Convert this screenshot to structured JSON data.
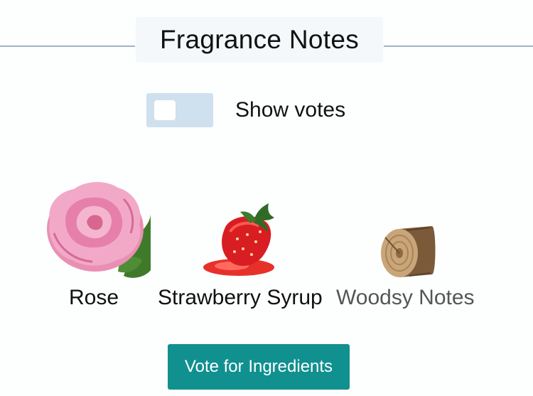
{
  "header": {
    "title": "Fragrance Notes"
  },
  "toggle": {
    "label": "Show votes",
    "checked": false
  },
  "notes": [
    {
      "label": "Rose",
      "icon": "rose-image"
    },
    {
      "label": "Strawberry Syrup",
      "icon": "strawberry-syrup-image"
    },
    {
      "label": "Woodsy Notes",
      "icon": "wood-log-image"
    }
  ],
  "actions": {
    "vote_label": "Vote for Ingredients"
  },
  "colors": {
    "accent": "#10908f",
    "toggle_track": "#cfe0ee",
    "divider": "#9fb3c8"
  }
}
